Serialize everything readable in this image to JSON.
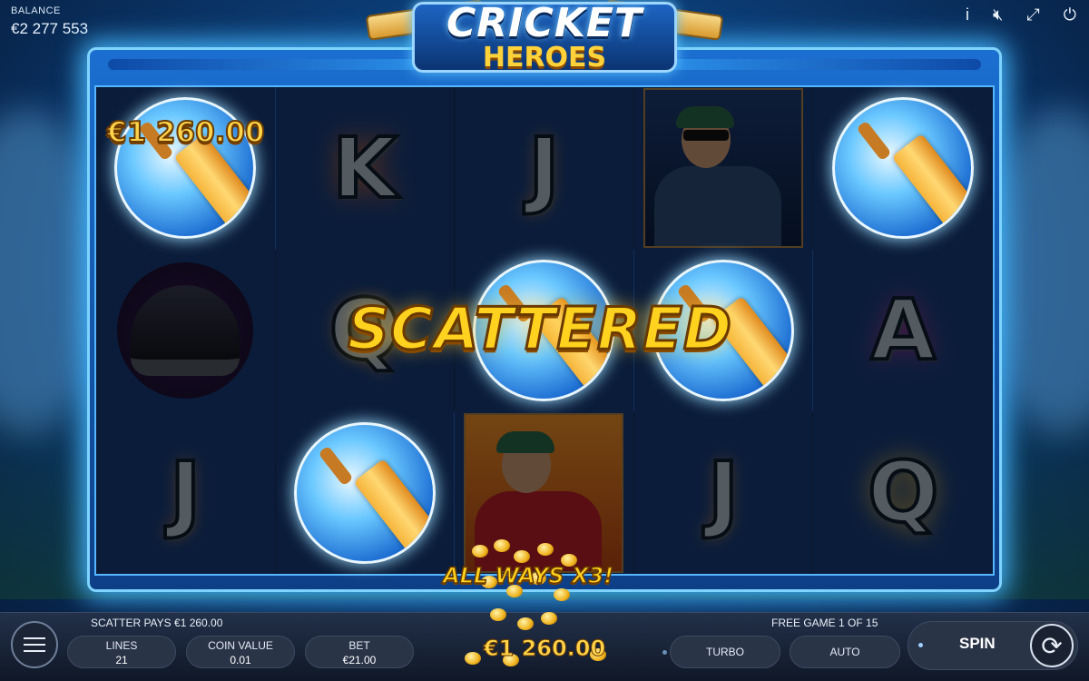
{
  "balance": {
    "label": "BALANCE",
    "value": "€2 277 553"
  },
  "top_icons": [
    "info-icon",
    "mute-icon",
    "fullscreen-icon",
    "power-icon"
  ],
  "logo": {
    "line1": "CRICKET",
    "line2": "HEROES"
  },
  "reels": [
    [
      "scatter-bat",
      "K",
      "J",
      "player-blue",
      "scatter-bat"
    ],
    [
      "helmet",
      "Q",
      "scatter-bat",
      "scatter-bat",
      "A"
    ],
    [
      "J",
      "scatter-bat",
      "player-red",
      "J",
      "Q"
    ]
  ],
  "overlay": {
    "scattered": "SCATTERED",
    "win_amount": "€1 260.00",
    "all_ways": "ALL WAYS X3!",
    "total_win": "€1 260.00"
  },
  "bottom_bar": {
    "scatter_pays": "SCATTER PAYS €1 260.00",
    "free_game": "FREE GAME 1 OF 15",
    "lines": {
      "label": "LINES",
      "value": "21"
    },
    "coin_value": {
      "label": "COIN VALUE",
      "value": "0.01"
    },
    "bet": {
      "label": "BET",
      "value": "€21.00"
    },
    "turbo": "TURBO",
    "auto": "AUTO",
    "spin": "SPIN"
  },
  "colors": {
    "accent": "#45b8ff",
    "gold": "#ffd21f",
    "panel": "#2a3447"
  }
}
